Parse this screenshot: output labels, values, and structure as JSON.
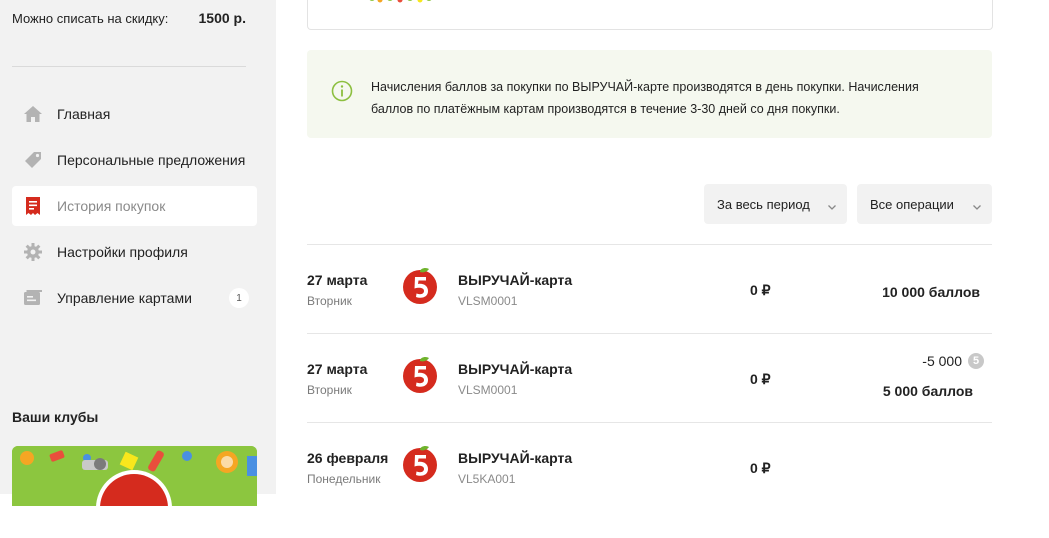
{
  "sidebar": {
    "discount_label": "Можно списать на скидку:",
    "discount_value": "1500 р.",
    "nav": [
      {
        "label": "Главная",
        "icon": "home-icon"
      },
      {
        "label": "Персональные предложения",
        "icon": "tag-icon"
      },
      {
        "label": "История покупок",
        "icon": "receipt-icon",
        "active": true
      },
      {
        "label": "Настройки профиля",
        "icon": "gear-icon"
      },
      {
        "label": "Управление картами",
        "icon": "cards-icon",
        "badge": "1"
      }
    ],
    "clubs_title": "Ваши клубы"
  },
  "info": {
    "text": "Начисления баллов за покупки по ВЫРУЧАЙ-карте производятся в день покупки. Начисления баллов по платёжным картам производятся в течение 3-30 дней со дня покупки."
  },
  "filters": {
    "period": "За весь период",
    "operations": "Все операции"
  },
  "transactions": [
    {
      "date": "27 марта",
      "weekday": "Вторник",
      "card": "ВЫРУЧАЙ-карта",
      "card_number": "VLSM0001",
      "amount": "0 ₽",
      "points": "10 000 баллов",
      "deduct": ""
    },
    {
      "date": "27 марта",
      "weekday": "Вторник",
      "card": "ВЫРУЧАЙ-карта",
      "card_number": "VLSM0001",
      "amount": "0 ₽",
      "points": "5 000 баллов",
      "deduct": "-5 000"
    },
    {
      "date": "26 февраля",
      "weekday": "Понедельник",
      "card": "ВЫРУЧАЙ-карта",
      "card_number": "VL5KA001",
      "amount": "0 ₽",
      "points": "",
      "deduct": ""
    }
  ],
  "colors": {
    "brand_red": "#d52b1e",
    "brand_green": "#6fb32c",
    "info_bg": "#f5f8ef"
  }
}
